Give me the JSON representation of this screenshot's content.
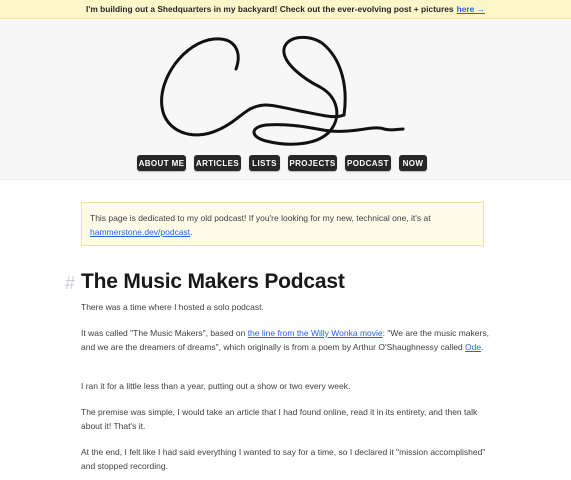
{
  "banner": {
    "text": "I'm building out a Shedquarters in my backyard! Check out the ever-evolving post + pictures",
    "link_label": "here →"
  },
  "header": {
    "logo_icon": "signature-logo-icon"
  },
  "nav": {
    "items": [
      {
        "label": "ABOUT ME"
      },
      {
        "label": "ARTICLES"
      },
      {
        "label": "LISTS"
      },
      {
        "label": "PROJECTS"
      },
      {
        "label": "PODCAST"
      },
      {
        "label": "NOW"
      }
    ]
  },
  "notice": {
    "text": "This page is dedicated to my old podcast! If you're looking for my new, technical one, it's at",
    "link_label": "hammerstone.dev/podcast",
    "suffix": "."
  },
  "article": {
    "anchor": "#",
    "title": "The Music Makers Podcast",
    "p1": "There was a time where I hosted a solo podcast.",
    "p2_a": "It was called \"The Music Makers\", based on",
    "p2_link": "the line from the Willy Wonka movie",
    "p2_b": ": \"We are the music makers, and we are the dreamers of dreams\", which originally is from a poem by Arthur O'Shaughnessy called",
    "p2_link2": "Ode",
    "p2_c": ".",
    "p3": "I ran it for a little less than a year, putting out a show or two every week.",
    "p4": "The premise was simple, I would take an article that I had found online, read it in its entirety, and then talk about it! That's it.",
    "p5": "At the end, I felt like I had said everything I wanted to say for a time, so I declared it \"mission accomplished\" and stopped recording."
  },
  "colors": {
    "banner_bg": "#fdf6c8",
    "nav_button": "#27272a",
    "link": "#2563eb",
    "notice_bg": "#fefce8"
  }
}
